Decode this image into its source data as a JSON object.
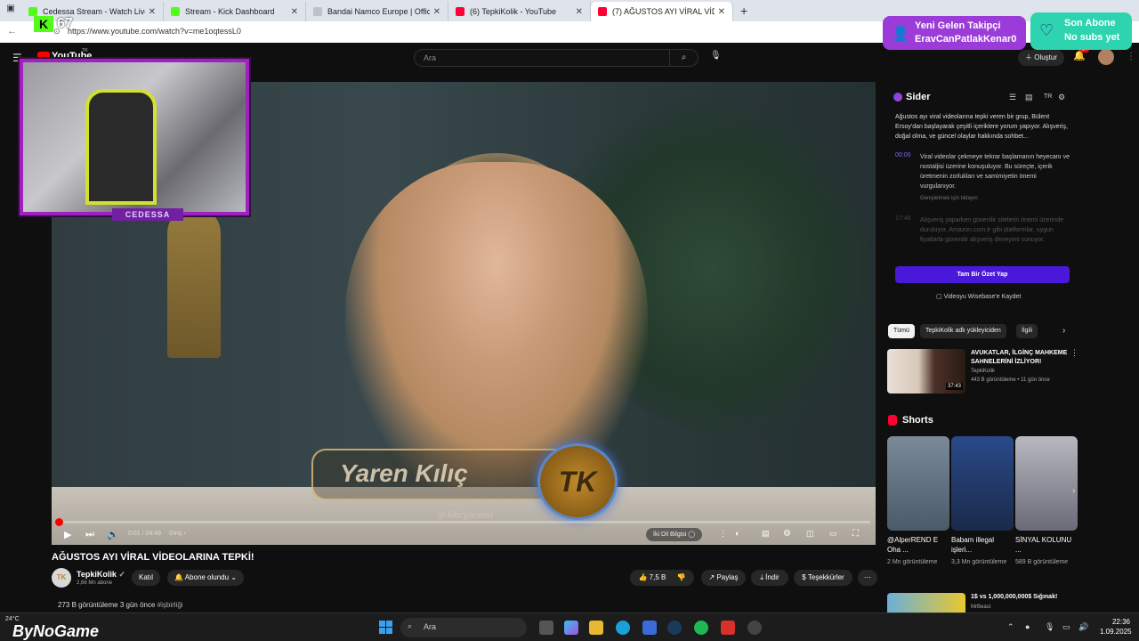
{
  "browser": {
    "tabs": [
      {
        "label": "Cedessa Stream - Watch Live on",
        "favicon_color": "#53fc18"
      },
      {
        "label": "Stream - Kick Dashboard",
        "favicon_color": "#53fc18"
      },
      {
        "label": "Bandai Namco Europe | Official S",
        "favicon_color": "#c0c0c8"
      },
      {
        "label": "(6) TepkiKolik - YouTube",
        "favicon_color": "#ff0033"
      },
      {
        "label": "(7) AĞUSTOS AYI VİRAL VİDEOLAR",
        "favicon_color": "#ff0033"
      }
    ],
    "url": "https://www.youtube.com/watch?v=me1oqtessL0"
  },
  "youtube": {
    "logo": "YouTube",
    "logo_suffix": "TR",
    "search_placeholder": "Ara",
    "create_label": "Oluştur",
    "notification_count": "9+"
  },
  "overlays": {
    "kick_badge": "K",
    "kick_count": "67",
    "cam_label": "CEDESSA",
    "follow_title": "Yeni Gelen Takipçi",
    "follow_name": "EravCanPatlakKenar0",
    "sub_title": "Son Abone",
    "sub_name": "No subs yet"
  },
  "video": {
    "lower_third_name": "Yaren Kılıç",
    "lower_third_handle": "kilicyarenn",
    "logo_text": "TK",
    "time": "0:01 / 24:49",
    "chapter": "Giriş",
    "dub_label": "İki Dil Bilgisi",
    "progress_fraction": 0.001
  },
  "meta": {
    "title": "AĞUSTOS AYI VİRAL VİDEOLARINA TEPKİ!",
    "channel": "TepkiKolik",
    "channel_initials": "TK",
    "subs": "2,66 Mn abone",
    "join": "Katıl",
    "subscribed": "Abone olundu",
    "likes": "7,5 B",
    "share": "Paylaş",
    "download": "İndir",
    "thanks": "Teşekkürler",
    "views": "273 B görüntüleme",
    "ago": "3 gün önce",
    "tag": "#işbirliği"
  },
  "sider": {
    "title": "Sider",
    "lang": "TR",
    "summary": "Ağustos ayı viral videolarına tepki veren bir grup, Bülent Ersoy'dan başlayarak çeşitli içeriklere yorum yapıyor. Alışveriş, doğal olma, ve güncel olaylar hakkında sohbet...",
    "ts1": "00:00",
    "p1": "Viral videolar çekmeye tekrar başlamanın heyecanı ve nostaljisi üzerine konuşuluyor. Bu süreçte, içerik üretmenin zorlukları ve samimiyetin önemi vurgulanıyor.",
    "more": "Genişletmek için tıklayın",
    "ts2": "17:46",
    "p2": "Alışveriş yaparken güvenilir sitelerin önemi üzerinde duruluyor. Amazon.com.tr gibi platformlar, uygun fiyatlarla güvenilir alışveriş deneyimi sunuyor.",
    "summary_button": "Tam Bir Özet Yap",
    "save_label": "Videoyu Wisebase'e Kaydet"
  },
  "chips": [
    "Tümü",
    "TepkiKolik adlı yükleyiciden",
    "İlgili"
  ],
  "rec": {
    "title": "AVUKATLAR, İLGİNÇ MAHKEME SAHNELERİNİ İZLİYOR!",
    "channel": "TepkiKolik",
    "meta": "443 B görüntüleme • 11 gün önce",
    "duration": "37:43"
  },
  "shorts": {
    "heading": "Shorts",
    "items": [
      {
        "title": "@AlperREND E Oha ...",
        "views": "2 Mn görüntüleme",
        "color": "#8a9aa8"
      },
      {
        "title": "Babam illegal işleri...",
        "views": "3,3 Mn görüntüleme",
        "color": "#2a3a6a"
      },
      {
        "title": "SİNYAL KOLUNU ...",
        "views": "589 B görüntüleme",
        "color": "#a8a8b0"
      }
    ]
  },
  "rec2": {
    "title": "1$ vs 1,000,000,000$ Sığınak!",
    "channel": "MrBeast"
  },
  "taskbar": {
    "weather": "24°C",
    "brand": "ByNoGame",
    "search": "Ara",
    "time": "22:36",
    "date": "1.09.2025"
  }
}
